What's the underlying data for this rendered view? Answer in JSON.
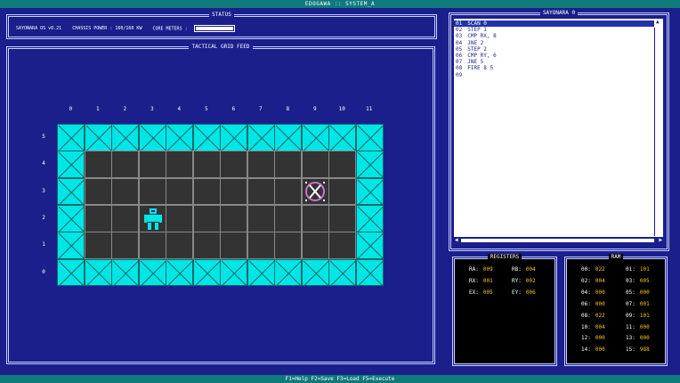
{
  "window_title": "EDOGAWA :: SYSTEM_A",
  "footer": "F1=Help F2=Save F3=Load F5=Execute",
  "status": {
    "title": "STATUS",
    "version": "SAYONARA OS v0.21",
    "chassis_power": "CHASSIS POWER : 160/160 KW",
    "core_meters_label": "CORE METERS :",
    "core_meter_fill": 1.0
  },
  "grid": {
    "title": "TACTICAL GRID FEED",
    "cols": 12,
    "rows": 6,
    "x_labels": [
      "0",
      "1",
      "2",
      "3",
      "4",
      "5",
      "6",
      "7",
      "8",
      "9",
      "10",
      "11"
    ],
    "y_labels": [
      "5",
      "4",
      "3",
      "2",
      "1",
      "0"
    ],
    "robot": {
      "x": 3,
      "y": 2
    },
    "target": {
      "x": 9,
      "y": 3
    }
  },
  "code": {
    "title": "SAYONARA 0",
    "lines": [
      {
        "n": "01",
        "text": "SCAN 0"
      },
      {
        "n": "02",
        "text": "STEP 1"
      },
      {
        "n": "03",
        "text": "CMP RX, 8"
      },
      {
        "n": "04",
        "text": "JNE 2"
      },
      {
        "n": "05",
        "text": "STEP 2"
      },
      {
        "n": "06",
        "text": "CMP RY, 6"
      },
      {
        "n": "07",
        "text": "JNE 5"
      },
      {
        "n": "08",
        "text": "FIRE 8 5"
      },
      {
        "n": "09",
        "text": ""
      }
    ],
    "selected_line": 0
  },
  "registers": {
    "title": "REGISTERS",
    "items": [
      {
        "k": "RA:",
        "v": "009"
      },
      {
        "k": "RB:",
        "v": "004"
      },
      {
        "k": "RX:",
        "v": "001"
      },
      {
        "k": "RY:",
        "v": "002"
      },
      {
        "k": "EX:",
        "v": "005"
      },
      {
        "k": "EY:",
        "v": "006"
      }
    ]
  },
  "ram": {
    "title": "RAM",
    "items": [
      {
        "k": "00:",
        "v": "022"
      },
      {
        "k": "01:",
        "v": "101"
      },
      {
        "k": "02:",
        "v": "004"
      },
      {
        "k": "03:",
        "v": "005"
      },
      {
        "k": "04:",
        "v": "000"
      },
      {
        "k": "05:",
        "v": "000"
      },
      {
        "k": "06:",
        "v": "000"
      },
      {
        "k": "07:",
        "v": "001"
      },
      {
        "k": "08:",
        "v": "022"
      },
      {
        "k": "09:",
        "v": "101"
      },
      {
        "k": "10:",
        "v": "004"
      },
      {
        "k": "11:",
        "v": "000"
      },
      {
        "k": "12:",
        "v": "000"
      },
      {
        "k": "13:",
        "v": "000"
      },
      {
        "k": "14:",
        "v": "000"
      },
      {
        "k": "15:",
        "v": "988"
      }
    ]
  }
}
